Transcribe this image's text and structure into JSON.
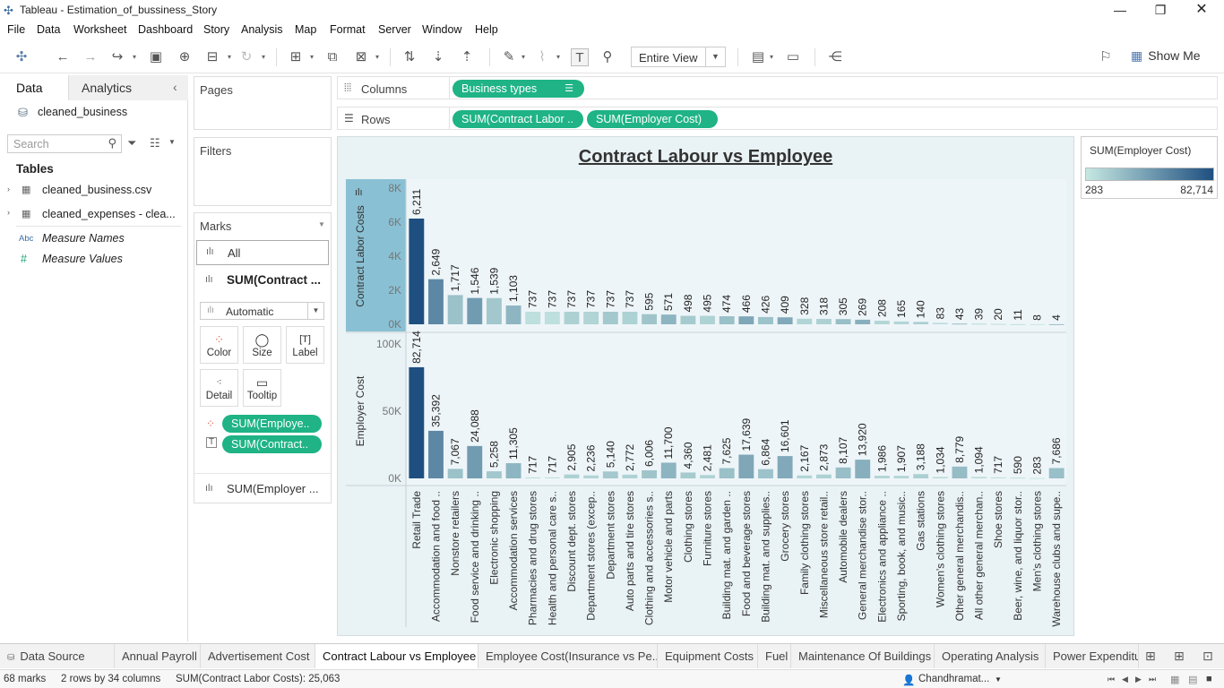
{
  "window": {
    "title": "Tableau - Estimation_of_bussiness_Story"
  },
  "menu": [
    "File",
    "Data",
    "Worksheet",
    "Dashboard",
    "Story",
    "Analysis",
    "Map",
    "Format",
    "Server",
    "Window",
    "Help"
  ],
  "toolbar": {
    "fit_value": "Entire View",
    "show_me": "Show Me"
  },
  "left_pane": {
    "tabs": [
      "Data",
      "Analytics"
    ],
    "datasource": "cleaned_business",
    "search_placeholder": "Search",
    "tables_header": "Tables",
    "tables": [
      "cleaned_business.csv",
      "cleaned_expenses - clea..."
    ],
    "measure_names": "Measure Names",
    "measure_values": "Measure Values",
    "abc_icon": "Abc",
    "hash_icon": "#"
  },
  "shelves": {
    "pages": "Pages",
    "filters": "Filters",
    "columns_label": "Columns",
    "rows_label": "Rows",
    "columns_pills": [
      "Business types"
    ],
    "rows_pills": [
      "SUM(Contract Labor ..",
      "SUM(Employer Cost)"
    ]
  },
  "marks": {
    "header": "Marks",
    "all": "All",
    "sheet1": "SUM(Contract ...",
    "mark_type": "Automatic",
    "buttons": [
      "Color",
      "Size",
      "Label",
      "Detail",
      "Tooltip"
    ],
    "pills": [
      "SUM(Employe..",
      "SUM(Contract.."
    ],
    "sheet2": "SUM(Employer ..."
  },
  "legend": {
    "title": "SUM(Employer Cost)",
    "min": "283",
    "max": "82,714"
  },
  "chart_data": {
    "type": "bar",
    "title": "Contract Labour vs Employee",
    "categories": [
      "Retail Trade",
      "Accommodation and food ..",
      "Nonstore retailers",
      "Food service and drinking ..",
      "Electronic shopping",
      "Accommodation services",
      "Pharmacies and drug stores",
      "Health and personal care s..",
      "Discount dept. stores",
      "Department stores (excep..",
      "Department stores",
      "Auto parts and tire stores",
      "Clothing and accessories s..",
      "Motor vehicle and parts",
      "Clothing stores",
      "Furniture stores",
      "Building mat. and garden ..",
      "Food and beverage stores",
      "Building mat. and supplies..",
      "Grocery stores",
      "Family clothing stores",
      "Miscellaneous store retail..",
      "Automobile dealers",
      "General merchandise stor..",
      "Electronics and appliance ..",
      "Sporting, book, and music..",
      "Gas stations",
      "Women's clothing stores",
      "Other general merchandis..",
      "All other general merchan..",
      "Shoe stores",
      "Beer, wine, and liquor stor..",
      "Men's clothing stores",
      "Warehouse clubs and supe.."
    ],
    "series": [
      {
        "name": "Contract Labor Costs",
        "values": [
          6211,
          2649,
          1717,
          1546,
          1539,
          1103,
          737,
          737,
          737,
          737,
          737,
          737,
          595,
          571,
          498,
          495,
          474,
          466,
          426,
          409,
          328,
          318,
          305,
          269,
          208,
          165,
          140,
          83,
          43,
          39,
          20,
          11,
          8,
          4
        ],
        "labels": [
          "6,211",
          "2,649",
          "1,717",
          "1,546",
          "1,539",
          "1,103",
          "737",
          "737",
          "737",
          "737",
          "737",
          "737",
          "595",
          "571",
          "498",
          "495",
          "474",
          "466",
          "426",
          "409",
          "328",
          "318",
          "305",
          "269",
          "208",
          "165",
          "140",
          "83",
          "43",
          "39",
          "20",
          "11",
          "8",
          "4"
        ],
        "ylabel": "Contract Labor Costs",
        "yticks": [
          "8K",
          "6K",
          "4K",
          "2K",
          "0K"
        ],
        "ylim": [
          0,
          8000
        ]
      },
      {
        "name": "Employer Cost",
        "values": [
          82714,
          35392,
          7067,
          24088,
          5258,
          11305,
          717,
          717,
          2905,
          2236,
          5140,
          2772,
          6006,
          11700,
          4360,
          2481,
          7625,
          17639,
          6864,
          16601,
          2167,
          2873,
          8107,
          13920,
          1986,
          1907,
          3188,
          1034,
          8779,
          1094,
          717,
          590,
          283,
          7686
        ],
        "labels": [
          "82,714",
          "35,392",
          "7,067",
          "24,088",
          "5,258",
          "11,305",
          "717",
          "717",
          "2,905",
          "2,236",
          "5,140",
          "2,772",
          "6,006",
          "11,700",
          "4,360",
          "2,481",
          "7,625",
          "17,639",
          "6,864",
          "16,601",
          "2,167",
          "2,873",
          "8,107",
          "13,920",
          "1,986",
          "1,907",
          "3,188",
          "1,034",
          "8,779",
          "1,094",
          "717",
          "590",
          "283",
          "7,686"
        ],
        "ylabel": "Employer Cost",
        "yticks": [
          "100K",
          "50K",
          "0K"
        ],
        "ylim": [
          0,
          100000
        ]
      }
    ],
    "color_by": "SUM(Employer Cost)",
    "color_range": [
      "#c6e8e2",
      "#1e4f80"
    ],
    "color_domain": [
      283,
      82714
    ]
  },
  "sheet_tabs": [
    "Data Source",
    "Annual Payroll",
    "Advertisement Cost",
    "Contract Labour vs Employee",
    "Employee Cost(Insurance vs Pe...",
    "Equipment Costs",
    "Fuel",
    "Maintenance Of Buildings",
    "Operating Analysis",
    "Power Expenditu"
  ],
  "active_tab": "Contract Labour vs Employee",
  "status": {
    "marks": "68 marks",
    "dims": "2 rows by 34 columns",
    "sum": "SUM(Contract Labor Costs): 25,063",
    "user": "Chandhramat..."
  }
}
